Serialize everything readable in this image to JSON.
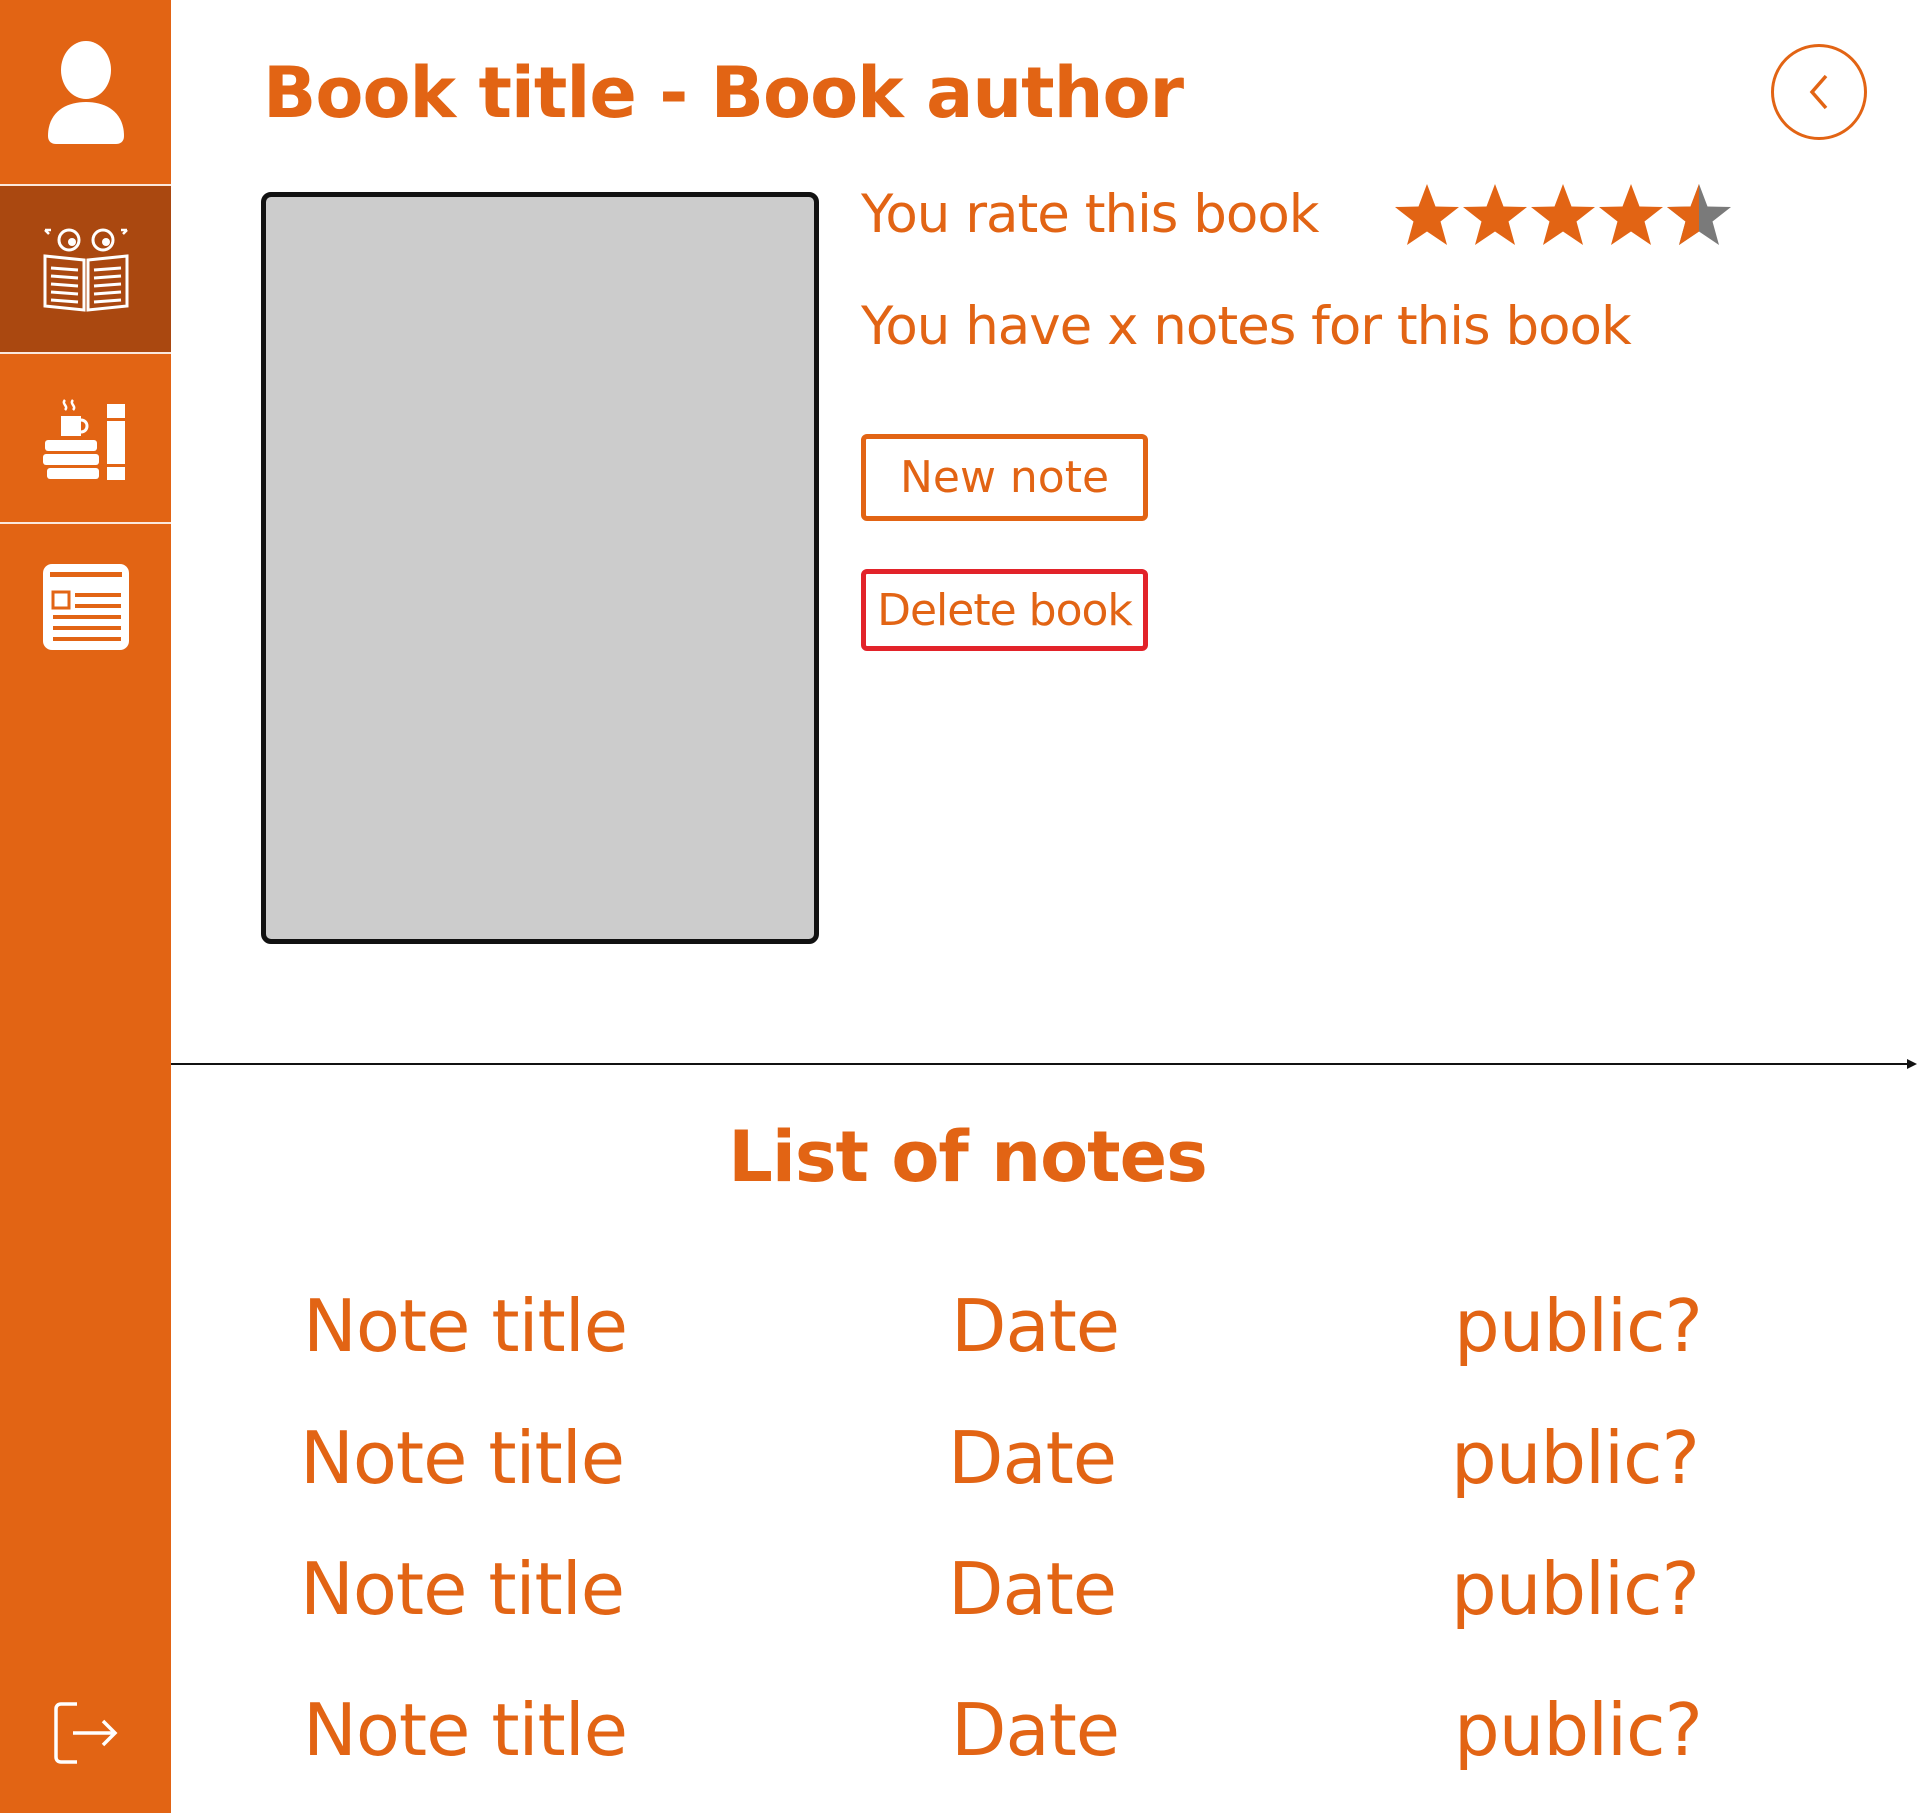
{
  "colors": {
    "accent": "#e26414",
    "sidebar_active": "#aa4810",
    "danger": "#e2232a",
    "cover_placeholder": "#cccccc"
  },
  "sidebar": {
    "items": [
      {
        "icon": "user-icon",
        "active": false
      },
      {
        "icon": "reading-book-icon",
        "active": true
      },
      {
        "icon": "book-stack-mug-icon",
        "active": false
      },
      {
        "icon": "news-article-icon",
        "active": false
      }
    ],
    "logout_icon": "logout-icon"
  },
  "header": {
    "title": "Book title - Book author",
    "back_icon": "chevron-left-icon"
  },
  "book": {
    "rating_label": "You rate this book",
    "rating": 4.5,
    "rating_max": 5,
    "notes_count_text": "You have x notes for this book",
    "new_note_label": "New note",
    "delete_book_label": "Delete book"
  },
  "notes": {
    "title": "List of notes",
    "rows": [
      {
        "title": "Note title",
        "date": "Date",
        "public": "public?"
      },
      {
        "title": "Note title",
        "date": "Date",
        "public": "public?"
      },
      {
        "title": "Note title",
        "date": "Date",
        "public": "public?"
      },
      {
        "title": "Note title",
        "date": "Date",
        "public": "public?"
      }
    ]
  }
}
